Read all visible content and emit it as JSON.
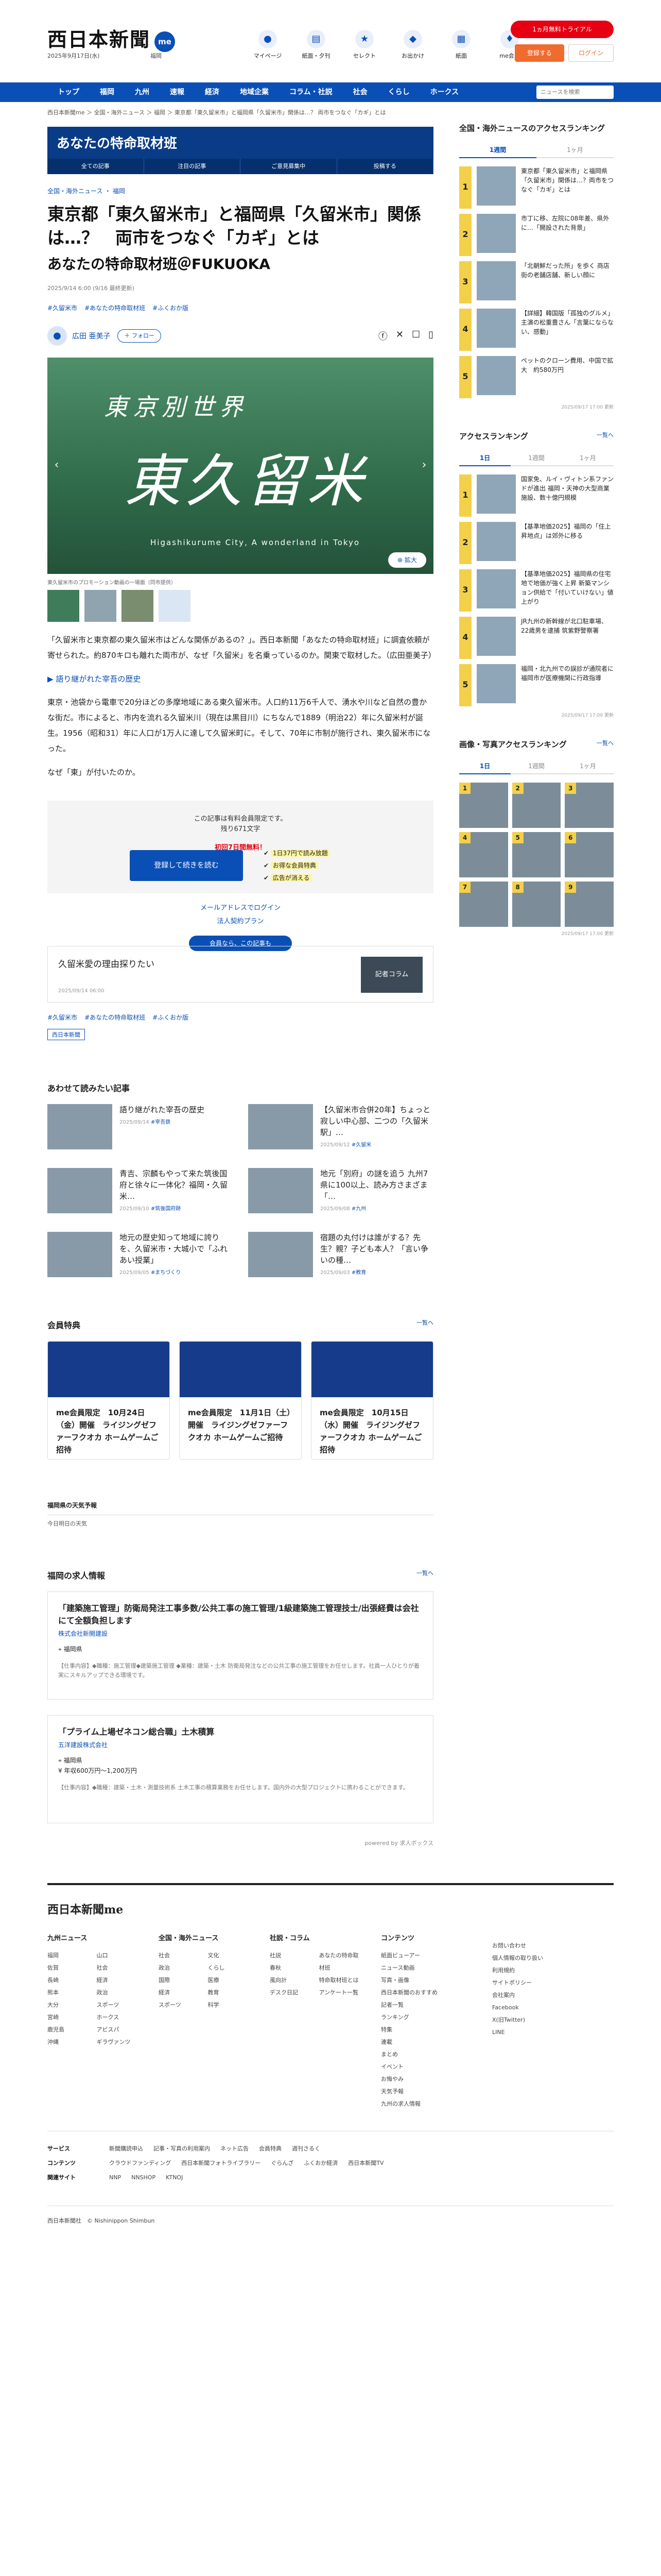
{
  "header": {
    "logo": "西日本新聞",
    "logo_badge": "me",
    "date": "2025年9月17日(水)",
    "location": "福岡",
    "icons": [
      {
        "label": "マイページ",
        "icon": "person-icon"
      },
      {
        "label": "紙面・夕刊",
        "icon": "newspaper-icon"
      },
      {
        "label": "セレクト",
        "icon": "star-icon"
      },
      {
        "label": "お出かけ",
        "icon": "footprints-icon"
      },
      {
        "label": "紙面",
        "icon": "paper-icon"
      },
      {
        "label": "me会員",
        "icon": "member-icon"
      }
    ],
    "promo": "1ヵ月無料トライアル",
    "register": "登録する",
    "login": "ログイン"
  },
  "nav": {
    "items": [
      "トップ",
      "福岡",
      "九州",
      "速報",
      "経済",
      "地域企業",
      "コラム・社説",
      "社会",
      "くらし",
      "ホークス"
    ],
    "search_placeholder": "ニュースを検索"
  },
  "breadcrumb": "西日本新聞me ＞ 全国・海外ニュース ＞ 福岡 ＞ 東京都「東久留米市」と福岡県「久留米市」関係は…？ 両市をつなぐ「カギ」とは",
  "banner": {
    "title": "あなたの特命取材班",
    "tabs": [
      "全ての記事",
      "注目の記事",
      "ご意見募集中",
      "投稿する"
    ]
  },
  "article": {
    "category": "全国・海外ニュース ・ 福岡",
    "title": "東京都「東久留米市」と福岡県「久留米市」関係は…？　両市をつなぐ「カギ」とは",
    "subtitle": "あなたの特命取材班＠FUKUOKA",
    "date": "2025/9/14 6:00 (9/16 最終更新)",
    "tags": [
      "#久留米市",
      "#あなたの特命取材班",
      "#ふくおか版"
    ],
    "author": "広田 亜美子",
    "follow": "＋ フォロー",
    "photo": {
      "line1": "東京別世界",
      "line2": "東久留米",
      "line3": "Higashikurume City, A wonderland in Tokyo",
      "zoom": "拡大"
    },
    "caption": "東久留米市のプロモーション動画の一場面（同市提供）",
    "paragraphs": [
      "「久留米市と東京都の東久留米市はどんな関係があるの？」。西日本新聞「あなたの特命取材班」に調査依頼が寄せられた。約870キロも離れた両市が、なぜ「久留米」を名乗っているのか。関東で取材した。（広田亜美子）"
    ],
    "section_heading": "語り継がれた宰吾の歴史",
    "paragraphs2": [
      "東京・池袋から電車で20分ほどの多摩地域にある東久留米市。人口約11万6千人で、湧水や川など自然の豊かな街だ。市によると、市内を流れる久留米川（現在は黒目川）にちなんで1889（明治22）年に久留米村が誕生。1956（昭和31）年に人口が1万人に達して久留米町に。そして、70年に市制が施行され、東久留米市になった。",
      "なぜ「東」が付いたのか。"
    ]
  },
  "paywall": {
    "notice": "この記事は有料会員限定です。",
    "remain": "残り671文字",
    "free": "初回7日間無料！",
    "button": "登録して続きを読む",
    "benefits": [
      "1日37円で読み放題",
      "お得な会員特典",
      "広告が消える"
    ],
    "login_link": "メールアドレスでログイン",
    "corp_link": "法人契約プラン",
    "member_pill": "会員なら、この記事も"
  },
  "member_card": {
    "title": "久留米愛の理由探りたい",
    "date": "2025/09/14 06:00",
    "image_label": "記者コラム"
  },
  "tags_bottom": [
    "#久留米市",
    "#あなたの特命取材班",
    "#ふくおか版"
  ],
  "source": "西日本新聞",
  "related": {
    "title": "あわせて読みたい記事",
    "items": [
      {
        "title": "語り継がれた宰吾の歴史",
        "date": "2025/09/14",
        "tag": "#宰吾鉄"
      },
      {
        "title": "【久留米市合併20年】ちょっと寂しい中心部、二つの「久留米駅」…",
        "date": "2025/09/12",
        "tag": "#久留米"
      },
      {
        "title": "青吉、宗麟もやって来た筑後国府と徐々に一体化？福岡・久留米…",
        "date": "2025/09/10",
        "tag": "#筑後国府跡"
      },
      {
        "title": "地元「別府」の謎を追う 九州7県に100以上、読み方さまざま「…",
        "date": "2025/09/08",
        "tag": "#九州"
      },
      {
        "title": "地元の歴史知って地域に誇りを、久留米市・大城小で「ふれあい授業」",
        "date": "2025/09/05",
        "tag": "#まちづくり"
      },
      {
        "title": "宿題の丸付けは誰がする？先生？親？子ども本人？「言い争いの種…",
        "date": "2025/09/03",
        "tag": "#教育"
      }
    ]
  },
  "benefits": {
    "title": "会員特典",
    "more": "一覧へ",
    "items": [
      "me会員限定　10月24日（金）開催　ライジングゼファーフクオカ ホームゲームご招待",
      "me会員限定　11月1日（土）開催　ライジングゼファーフクオカ ホームゲームご招待",
      "me会員限定　10月15日（水）開催　ライジングゼファーフクオカ ホームゲームご招待"
    ]
  },
  "weather": {
    "title": "福岡県の天気予報",
    "sub": "今日明日の天気"
  },
  "jobs": {
    "title": "福岡の求人情報",
    "more": "一覧へ",
    "items": [
      {
        "title": "「建築施工管理」防衛局発注工事多数/公共工事の施工管理/1級建築施工管理技士/出張経費は会社にて全額負担します",
        "company": "株式会社新開建設",
        "location": "福岡県",
        "salary": "",
        "desc": "【仕事内容】◆職種：施工管理◆建築施工管理 ◆業種：建築・土木 防衛局発注などの公共工事の施工管理をお任せします。社員一人ひとりが着実にスキルアップできる環境です。"
      },
      {
        "title": "「プライム上場ゼネコン総合職」土木積算",
        "company": "五洋建設株式会社",
        "location": "福岡県",
        "salary": "年収600万円〜1,200万円",
        "desc": "【仕事内容】◆職種：建築・土木・測量技術系 土木工事の積算業務をお任せします。国内外の大型プロジェクトに携わることができます。"
      }
    ],
    "powered": "powered by 求人ボックス"
  },
  "sidebar": {
    "ranking1": {
      "title": "全国・海外ニュースのアクセスランキング",
      "tabs": [
        "1週間",
        "1ヶ月"
      ],
      "items": [
        "東京都「東久留米市」と福岡県「久留米市」関係は…？両市をつなぐ「カギ」とは",
        "市丁に移、左院に08年差、県外に…「開設された背景」",
        "「北朝鮮だった所」を歩く 商店街の老舗店舗、新しい顔に",
        "【詳細】韓国版「孤独のグルメ」主演の松重豊さん「言葉にならない、感動」",
        "ペットのクローン費用、中国で拡大　約580万円"
      ],
      "updated": "2025/09/17 17:00 更新"
    },
    "ranking2": {
      "title": "アクセスランキング",
      "more": "一覧へ",
      "tabs": [
        "1日",
        "1週間",
        "1ヶ月"
      ],
      "items": [
        "国家免、ルイ・ヴィトン系ファンドが進出 福岡・天神の大型商業施設、数十億円規模",
        "【基準地価2025】福岡の「住上昇地点」は郊外に移る",
        "【基準地価2025】福岡県の住宅地で地価が強く上昇 新築マンション供給で「付いていけない」値上がり",
        "JR九州の新幹線が北口駐車場、22歳男を逮捕 筑紫野警察署",
        "福岡・北九州での誤診が通院者に 福岡市が医療機関に行政指導"
      ],
      "updated": "2025/09/17 17:00 更新"
    },
    "photo_rank": {
      "title": "画像・写真アクセスランキング",
      "more": "一覧へ",
      "tabs": [
        "1日",
        "1週間",
        "1ヶ月"
      ],
      "items": [
        "1",
        "2",
        "3",
        "4",
        "5",
        "6",
        "7",
        "8",
        "9"
      ],
      "updated": "2025/09/17 17:00 更新"
    }
  },
  "footer": {
    "logo": "西日本新聞me",
    "cols": [
      {
        "title": "九州ニュース",
        "items": [
          "福岡",
          "佐賀",
          "長崎",
          "熊本",
          "大分",
          "宮崎",
          "鹿児島",
          "沖縄",
          "山口",
          "社会",
          "経済",
          "政治",
          "スポーツ",
          "ホークス",
          "アビスパ",
          "ギラヴァンツ"
        ]
      },
      {
        "title": "全国・海外ニュース",
        "items": [
          "社会",
          "政治",
          "国際",
          "経済",
          "スポーツ",
          "文化",
          "くらし",
          "医療",
          "教育",
          "科学"
        ]
      },
      {
        "title": "社説・コラム",
        "items": [
          "社説",
          "春秋",
          "風向計",
          "デスク日記",
          "あなたの特命取材班",
          "特命取材班とは",
          "アンケート一覧"
        ]
      },
      {
        "title": "コンテンツ",
        "items": [
          "紙面ビューアー",
          "ニュース動画",
          "写真・画像",
          "西日本新聞のおすすめ",
          "記者一覧",
          "ランキング",
          "特集",
          "連載",
          "まとめ",
          "イベント",
          "お悔やみ",
          "天気予報",
          "九州の求人情報"
        ]
      },
      {
        "title": "",
        "items": [
          "お問い合わせ",
          "個人情報の取り扱い",
          "利用規約",
          "サイトポリシー",
          "会社案内",
          "Facebook",
          "X(旧Twitter)",
          "LINE"
        ]
      }
    ],
    "rows": [
      {
        "label": "サービス",
        "items": [
          "新聞購読申込",
          "記事・写真の利用案内",
          "ネット広告",
          "会員特典",
          "週刊さるく"
        ]
      },
      {
        "label": "コンテンツ",
        "items": [
          "クラウドファンディング",
          "西日本新聞フォトライブラリー",
          "ぐらんざ",
          "ふくおか経済",
          "西日本新聞TV"
        ]
      },
      {
        "label": "関連サイト",
        "items": [
          "NNP",
          "NNSHOP",
          "KTNOJ"
        ]
      }
    ],
    "copyright": "西日本新聞社　© Nishinippon Shimbun"
  }
}
